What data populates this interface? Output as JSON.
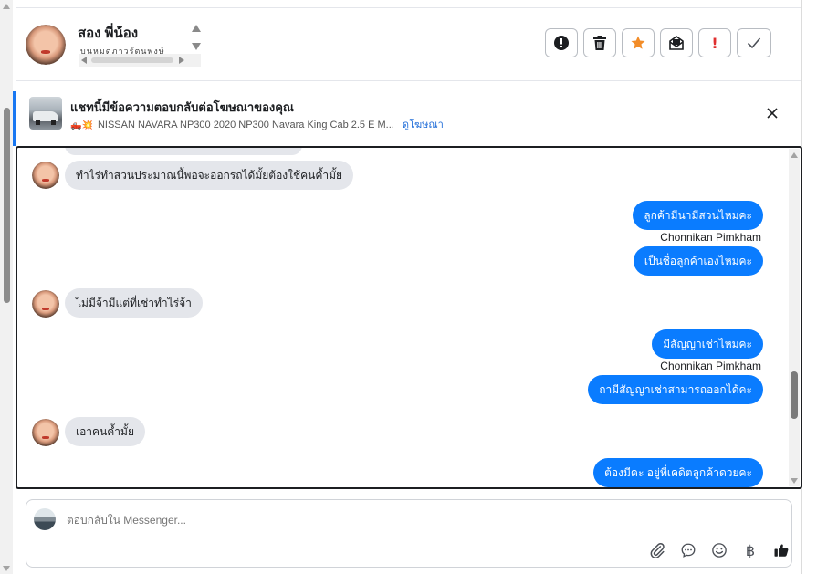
{
  "contact": {
    "name": "สอง พี่น้อง",
    "subtitle": "บนหมดภาวรัตนพงษ์"
  },
  "header_actions": [
    {
      "name": "report-icon",
      "label": "report"
    },
    {
      "name": "trash-icon",
      "label": "delete"
    },
    {
      "name": "star-icon",
      "label": "star"
    },
    {
      "name": "mail-icon",
      "label": "mark unread"
    },
    {
      "name": "exclamation-icon",
      "label": "important"
    },
    {
      "name": "check-icon",
      "label": "done"
    }
  ],
  "ad_banner": {
    "title": "แชทนี้มีข้อความตอบกลับต่อโฆษณาของคุณ",
    "subtitle": "NISSAN NAVARA NP300 2020 NP300 Navara King Cab 2.5 E M...",
    "emoji": "🛻💥",
    "link": "ดูโฆษณา"
  },
  "messages": {
    "m1": "ทำไร่ทำสวนประมาณนี้พอจะออกรถได้มั้ยต้องใช้คนค้ำมั้ย",
    "m2": "ลูกค้ามีนามีสวนไหมคะ",
    "s1": "Chonnikan Pimkham",
    "m3": "เป็นชื่อลูกค้าเองไหมคะ",
    "m4": "ไม่มีจ้ามีแต่ที่เช่าทำไร่จ้า",
    "m5": "มีสัญญาเช่าไหมคะ",
    "s2": "Chonnikan Pimkham",
    "m6": "ถามีสัญญาเช่าสามารถออกได้คะ",
    "m7": "เอาคนค้ำมั้ย",
    "m8": "ต้องมีคะ อยู่ที่เคดิตลูกค้าดวยคะ"
  },
  "composer": {
    "placeholder": "ตอบกลับใน Messenger..."
  },
  "composer_tools": {
    "baht": "฿"
  },
  "colors": {
    "accent": "#0a7cff",
    "incoming_bubble": "#e4e6eb",
    "link": "#1d6bd8"
  }
}
